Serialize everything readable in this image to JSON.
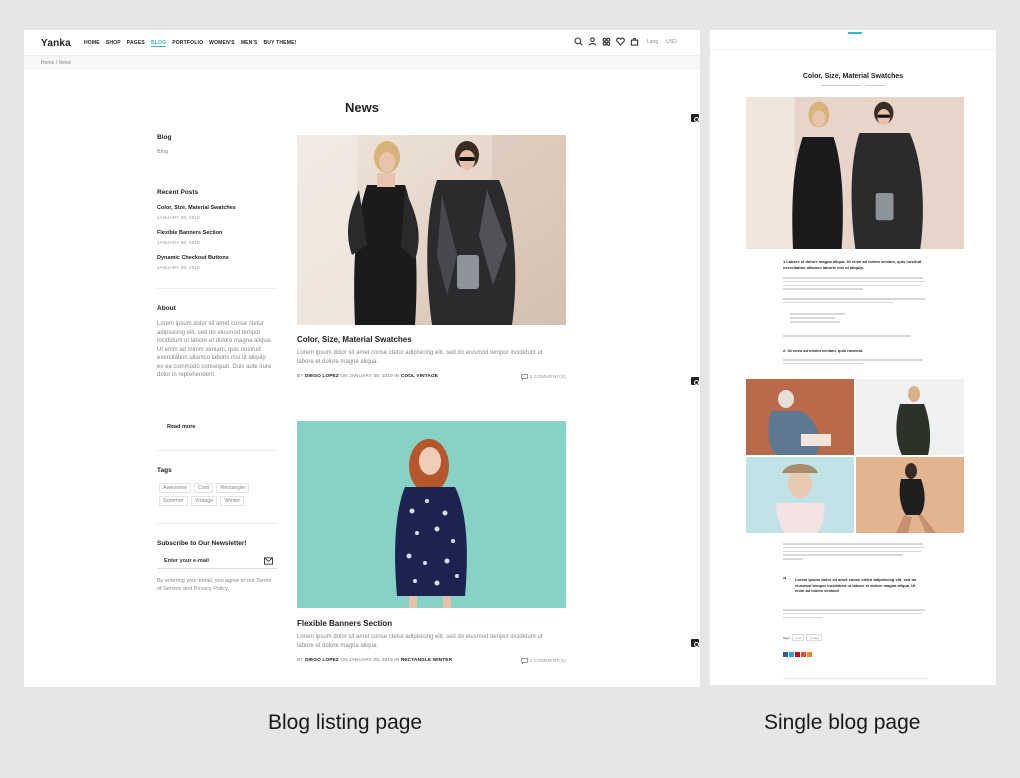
{
  "listing": {
    "logo": "Yanka",
    "nav": [
      "HOME",
      "SHOP",
      "PAGES",
      "BLOG",
      "PORTFOLIO",
      "WOMEN'S",
      "MEN'S",
      "BUY THEME!"
    ],
    "nav_active": "BLOG",
    "header_icons": [
      "search-icon",
      "user-icon",
      "compare-icon",
      "heart-icon",
      "cart-icon"
    ],
    "language": "Lang",
    "currency": "USD",
    "breadcrumb": "Home / News",
    "page_title": "News",
    "sidebar": {
      "blog_heading": "Blog",
      "blog_link": "Blog",
      "recent_heading": "Recent Posts",
      "recent_posts": [
        {
          "title": "Color, Size, Material Swatches",
          "date": "JANUARY 08, 2019"
        },
        {
          "title": "Flexible Banners Section",
          "date": "JANUARY 08, 2019"
        },
        {
          "title": "Dynamic Checkout Buttons",
          "date": "JANUARY 08, 2019"
        }
      ],
      "about_heading": "About",
      "about_text": "Lorem ipsum dolor sit amet conse ctetur adipisicing elit, sed do eiusmod tempor incididunt ut labore et dolore magna aliqua. Ut enim ad minim veniam, quis nostrud exercitation ullamco laboris nisi ut aliquip ex ea commodo consequat. Duis aute irure dolor in reprehenderit.",
      "read_more": "Read more",
      "tags_heading": "Tags",
      "tags": [
        "Awesome",
        "Cool",
        "Rectangle",
        "Summer",
        "Vintage",
        "Winter"
      ],
      "newsletter_heading": "Subscribe to Our Newsletter!",
      "newsletter_placeholder": "Enter your e-mail",
      "newsletter_note": "By entering your email, you agree to our Terms of Service and Privacy Policy."
    },
    "posts": [
      {
        "title": "Color, Size, Material Swatches",
        "excerpt": "Lorem ipsum dolor sit amet conse ctetur adipisicing elit, sed do eiusmod tempor incididunt ut labore et dolore magna aliqua.",
        "by": "BY",
        "author": "DIEGO LOPEZ",
        "on": "ON JANUARY 08, 2019",
        "in": "IN",
        "categories": "COOL VINTAGE",
        "comments": "2 COMMENT(S)"
      },
      {
        "title": "Flexible Banners Section",
        "excerpt": "Lorem ipsum dolor sit amet conse ctetur adipisicing elit, sed do eiusmod tempor incididunt ut labore et dolore magna aliqua.",
        "by": "BY",
        "author": "DIEGO LOPEZ",
        "on": "ON JANUARY 08, 2019",
        "in": "IN",
        "categories": "RECTANGLE WINTER",
        "comments": "1 COMMENT(S)"
      }
    ]
  },
  "single": {
    "title": "Color, Size, Material Swatches",
    "lead": "1.Labore et dolore magna aliqua. Ut enim ad minim veniam, quis nostrud exercitation ullamco laboris nisi ut aliquip.",
    "subheading": "2. Ut enim ad minim veniam, quis nostrud.",
    "quote": "Lorem ipsum dolor sit amet conse ctetur adipisicing elit, sed do eiusmod tempor incididunt ut labore et dolore magna aliqua. Ut enim ad minim veniam!",
    "quote_mark": "“",
    "tags_label": "Tags:"
  },
  "captions": {
    "left": "Blog listing page",
    "right": "Single blog page"
  },
  "colors": {
    "accent": "#35b7c4",
    "background": "#e5e6e8",
    "mint_banner": "#88d1c6"
  }
}
